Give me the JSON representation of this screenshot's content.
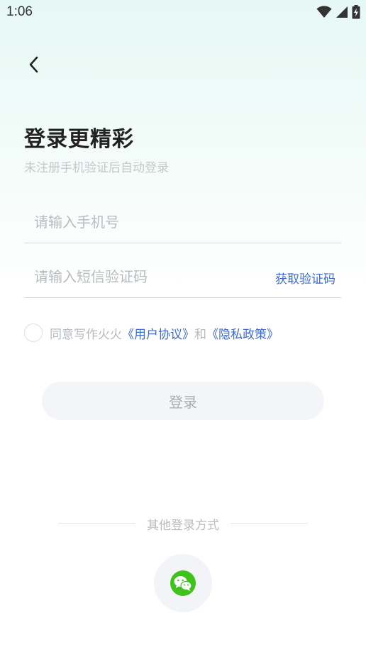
{
  "status_bar": {
    "time": "1:06",
    "icons": [
      "wifi-icon",
      "signal-icon",
      "battery-charging-icon"
    ]
  },
  "header": {
    "back_icon": "chevron-left-icon",
    "title": "登录更精彩",
    "subtitle": "未注册手机验证后自动登录"
  },
  "form": {
    "phone_placeholder": "请输入手机号",
    "phone_value": "",
    "code_placeholder": "请输入短信验证码",
    "code_value": "",
    "get_code_label": "获取验证码"
  },
  "agreement": {
    "checked": false,
    "prefix": "同意写作火火",
    "user_agreement": "《用户协议》",
    "conjunction": "和",
    "privacy_policy": "《隐私政策》"
  },
  "login_button_label": "登录",
  "other_login": {
    "label": "其他登录方式",
    "wechat_icon": "wechat-icon"
  },
  "colors": {
    "link": "#3d6bcf",
    "wechat_green": "#3fc21a",
    "button_bg": "#f4f5f8"
  }
}
